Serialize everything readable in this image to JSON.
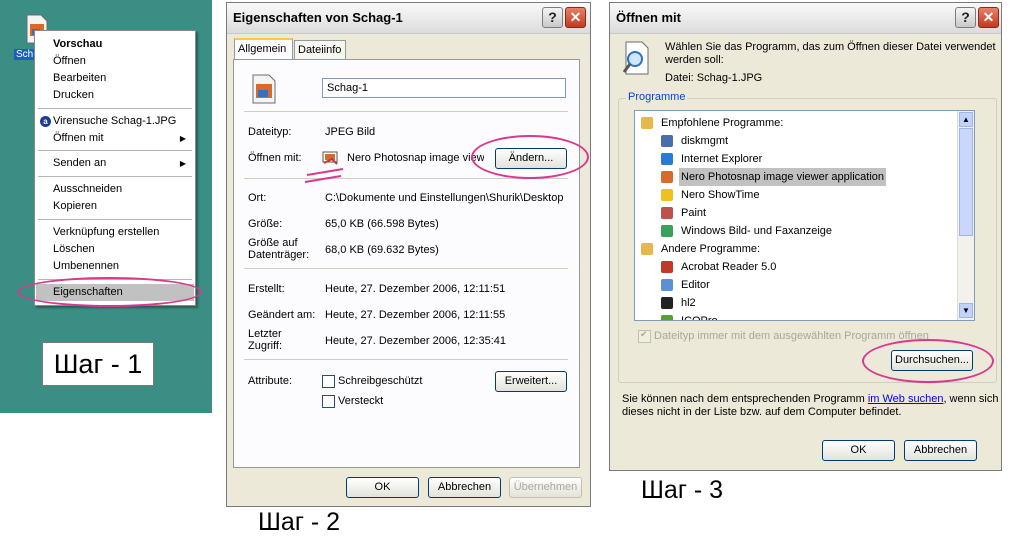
{
  "panel1": {
    "file_label": "Sch",
    "menu": [
      {
        "label": "Vorschau",
        "bold": true
      },
      {
        "label": "Öffnen"
      },
      {
        "label": "Bearbeiten"
      },
      {
        "label": "Drucken"
      },
      {
        "label": "Virensuche Schag-1.JPG",
        "icon": "antivirus-icon"
      },
      {
        "label": "Öffnen mit",
        "submenu": true
      },
      {
        "label": "Senden an",
        "submenu": true
      },
      {
        "label": "Ausschneiden"
      },
      {
        "label": "Kopieren"
      },
      {
        "label": "Verknüpfung erstellen"
      },
      {
        "label": "Löschen"
      },
      {
        "label": "Umbenennen"
      },
      {
        "label": "Eigenschaften",
        "selected": true
      }
    ],
    "step": "Шаг - 1"
  },
  "panel2": {
    "title": "Eigenschaften von Schag-1",
    "tabs": [
      "Allgemein",
      "Dateiinfo"
    ],
    "filename": "Schag-1",
    "rows": {
      "dateityp_label": "Dateityp:",
      "dateityp_value": "JPEG Bild",
      "oeffnen_label": "Öffnen mit:",
      "oeffnen_value": "Nero Photosnap image viewe",
      "aendern": "Ändern...",
      "ort_label": "Ort:",
      "ort_value": "C:\\Dokumente und Einstellungen\\Shurik\\Desktop",
      "groesse_label": "Größe:",
      "groesse_value": "65,0 KB (66.598 Bytes)",
      "gda_label1": "Größe auf",
      "gda_label2": "Datenträger:",
      "gda_value": "68,0 KB (69.632 Bytes)",
      "erstellt_label": "Erstellt:",
      "erstellt_value": "Heute, 27. Dezember 2006, 12:11:51",
      "geaendert_label": "Geändert am:",
      "geaendert_value": "Heute, 27. Dezember 2006, 12:11:55",
      "zugriff_label1": "Letzter",
      "zugriff_label2": "Zugriff:",
      "zugriff_value": "Heute, 27. Dezember 2006, 12:35:41",
      "attribute_label": "Attribute:",
      "schreibgeschuetzt": "Schreibgeschützt",
      "versteckt": "Versteckt",
      "erweitert": "Erweitert..."
    },
    "buttons": {
      "ok": "OK",
      "abbrechen": "Abbrechen",
      "uebernehmen": "Übernehmen"
    },
    "step": "Шаг - 2"
  },
  "panel3": {
    "title": "Öffnen mit",
    "intro1": "Wählen Sie das Programm, das zum Öffnen dieser Datei verwendet",
    "intro2": "werden soll:",
    "datei": "Datei:  Schag-1.JPG",
    "group_label": "Programme",
    "programs": [
      {
        "label": "Empfohlene Programme:",
        "indent": 0,
        "icon": "program-group-icon"
      },
      {
        "label": "diskmgmt",
        "indent": 1,
        "icon": "diskmgmt-icon"
      },
      {
        "label": "Internet Explorer",
        "indent": 1,
        "icon": "internet-explorer-icon"
      },
      {
        "label": "Nero Photosnap image viewer application",
        "indent": 1,
        "icon": "nero-photosnap-icon",
        "selected": true
      },
      {
        "label": "Nero ShowTime",
        "indent": 1,
        "icon": "nero-showtime-icon"
      },
      {
        "label": "Paint",
        "indent": 1,
        "icon": "paint-icon"
      },
      {
        "label": "Windows Bild- und Faxanzeige",
        "indent": 1,
        "icon": "picture-viewer-icon"
      },
      {
        "label": "Andere Programme:",
        "indent": 0,
        "icon": "program-group-icon"
      },
      {
        "label": "Acrobat Reader 5.0",
        "indent": 1,
        "icon": "acrobat-icon"
      },
      {
        "label": "Editor",
        "indent": 1,
        "icon": "notepad-icon"
      },
      {
        "label": "hl2",
        "indent": 1,
        "icon": "hl2-icon"
      },
      {
        "label": "ICQPro",
        "indent": 1,
        "icon": "icq-icon"
      }
    ],
    "always_use": "Dateityp immer mit dem ausgewählten Programm öffnen",
    "durchsuchen": "Durchsuchen...",
    "web_pre": "Sie können nach dem entsprechenden Programm ",
    "web_link": "im Web suchen",
    "web_post": ", wenn sich",
    "web_line2": "dieses nicht in der Liste bzw. auf dem Computer befindet.",
    "buttons": {
      "ok": "OK",
      "abbrechen": "Abbrechen"
    },
    "step": "Шаг - 3"
  },
  "colors": {
    "desktop": "#3a8e84",
    "highlight": "#d8398f",
    "link": "#0000ff"
  }
}
